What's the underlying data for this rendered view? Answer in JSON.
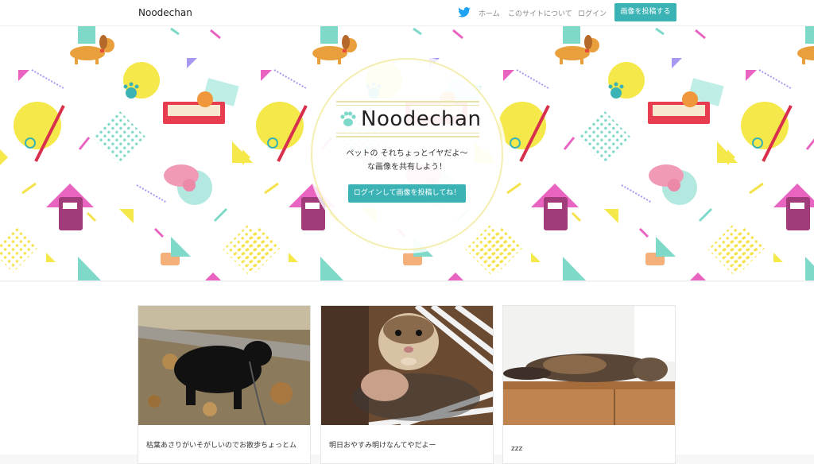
{
  "navbar": {
    "brand": "Noodechan",
    "links": {
      "home": "ホーム",
      "about": "このサイトについて",
      "login": "ログイン"
    },
    "post_button": "画像を投稿する",
    "twitter_icon": "twitter-bird-icon"
  },
  "hero": {
    "logo_text": "Noodechan",
    "tagline_line1": "ペットの それちょっとイヤだよ〜",
    "tagline_line2": "な画像を共有しよう！",
    "cta_button": "ログインして画像を投稿してね！"
  },
  "cards": [
    {
      "caption": "枯葉あさりがいそがしいのでお散歩ちょっとム"
    },
    {
      "caption": "明日おやすみ明けなんてやだよー"
    },
    {
      "caption": "zzz"
    }
  ],
  "colors": {
    "accent": "#3bb3b5"
  }
}
